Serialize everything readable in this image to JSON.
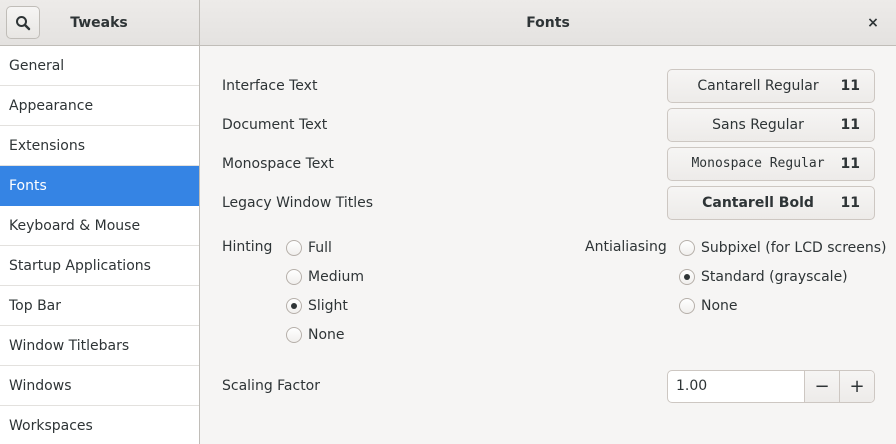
{
  "header": {
    "app_title": "Tweaks",
    "page_title": "Fonts",
    "close_glyph": "×"
  },
  "sidebar": {
    "items": [
      {
        "label": "General"
      },
      {
        "label": "Appearance"
      },
      {
        "label": "Extensions"
      },
      {
        "label": "Fonts",
        "selected": true
      },
      {
        "label": "Keyboard & Mouse"
      },
      {
        "label": "Startup Applications"
      },
      {
        "label": "Top Bar"
      },
      {
        "label": "Window Titlebars"
      },
      {
        "label": "Windows"
      },
      {
        "label": "Workspaces"
      }
    ]
  },
  "fonts": {
    "interface": {
      "label": "Interface Text",
      "font": "Cantarell Regular",
      "size": "11"
    },
    "document": {
      "label": "Document Text",
      "font": "Sans Regular",
      "size": "11"
    },
    "monospace": {
      "label": "Monospace Text",
      "font": "Monospace Regular",
      "size": "11"
    },
    "legacy": {
      "label": "Legacy Window Titles",
      "font": "Cantarell Bold",
      "size": "11"
    }
  },
  "hinting": {
    "label": "Hinting",
    "options": [
      "Full",
      "Medium",
      "Slight",
      "None"
    ],
    "selected": "Slight"
  },
  "antialiasing": {
    "label": "Antialiasing",
    "options": [
      "Subpixel (for LCD screens)",
      "Standard (grayscale)",
      "None"
    ],
    "selected": "Standard (grayscale)"
  },
  "scaling": {
    "label": "Scaling Factor",
    "value": "1.00",
    "minus": "−",
    "plus": "+"
  },
  "colors": {
    "accent": "#3584e4",
    "text": "#2e3436",
    "background": "#f6f5f4"
  },
  "icons": {
    "search": "search-icon",
    "close": "close-icon"
  }
}
